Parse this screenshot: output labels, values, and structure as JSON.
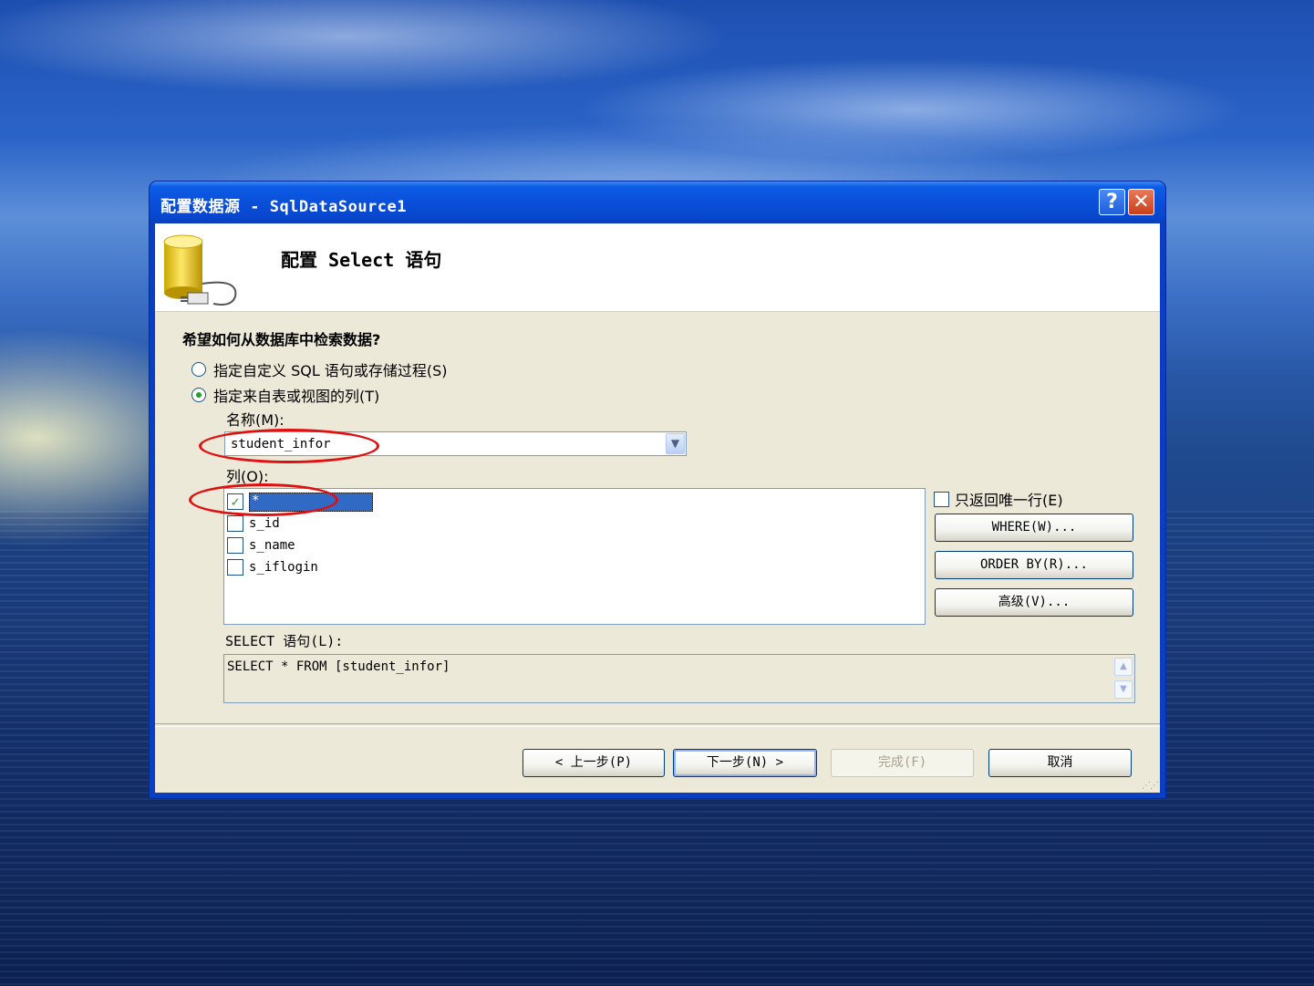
{
  "window": {
    "title": "配置数据源 - SqlDataSource1",
    "help_label": "?",
    "close_label": "✕"
  },
  "header": {
    "title": "配置 Select 语句",
    "icon": "database-plug-icon"
  },
  "question": "希望如何从数据库中检索数据?",
  "options": [
    {
      "label": "指定自定义 SQL 语句或存储过程(S)",
      "selected": false
    },
    {
      "label": "指定来自表或视图的列(T)",
      "selected": true
    }
  ],
  "name_field": {
    "label": "名称(M):",
    "value": "student_infor"
  },
  "columns": {
    "label": "列(O):",
    "items": [
      {
        "label": "*",
        "checked": true
      },
      {
        "label": "s_id",
        "checked": false
      },
      {
        "label": "s_name",
        "checked": false
      },
      {
        "label": "s_iflogin",
        "checked": false
      }
    ]
  },
  "side": {
    "unique_label": "只返回唯一行(E)",
    "where_label": "WHERE(W)...",
    "orderby_label": "ORDER BY(R)...",
    "advanced_label": "高级(V)..."
  },
  "sql": {
    "label": "SELECT 语句(L):",
    "value": "SELECT * FROM [student_infor]"
  },
  "footer": {
    "back_label": "< 上一步(P)",
    "next_label": "下一步(N) >",
    "finish_label": "完成(F)",
    "cancel_label": "取消"
  },
  "colors": {
    "title_bar": "#0a4fd9",
    "dialog_bg": "#ece9d8",
    "highlight": "#e01010",
    "selection": "#316ac5"
  }
}
